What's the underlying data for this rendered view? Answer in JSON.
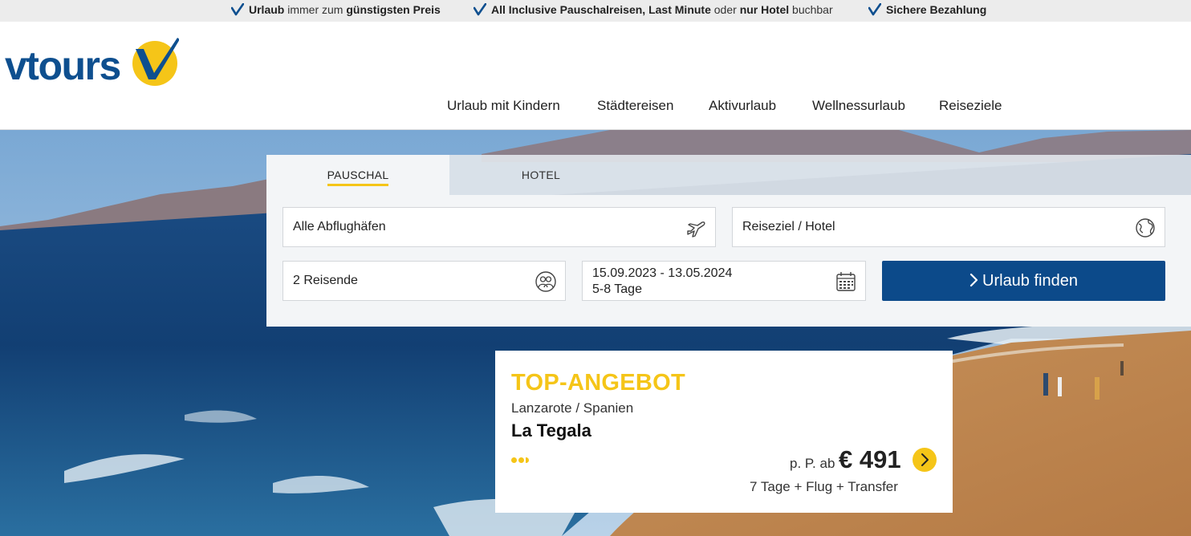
{
  "usp": {
    "item1": {
      "bold1": "Urlaub",
      "text1": " immer zum ",
      "bold2": "günstigsten Preis"
    },
    "item2": {
      "bold1": "All Inclusive Pauschalreisen, Last Minute",
      "text1": " oder ",
      "bold2": "nur Hotel",
      "text2": " buchbar"
    },
    "item3": {
      "bold1": "Sichere Bezahlung"
    }
  },
  "header": {
    "logo_text": "vtours",
    "nav": [
      "Urlaub mit Kindern",
      "Städtereisen",
      "Aktivurlaub",
      "Wellnessurlaub",
      "Reiseziele"
    ]
  },
  "search": {
    "tabs": [
      "PAUSCHAL",
      "HOTEL"
    ],
    "active_tab": "PAUSCHAL",
    "departure": {
      "value": "Alle Abflughäfen",
      "icon": "plane-icon"
    },
    "destination": {
      "placeholder": "Reiseziel / Hotel",
      "icon": "globe-icon"
    },
    "travelers": {
      "value": "2 Reisende",
      "icon": "travelers-icon"
    },
    "dates": {
      "range": "15.09.2023 - 13.05.2024",
      "duration": "5-8 Tage",
      "icon": "calendar-icon"
    },
    "submit_label": "Urlaub finden"
  },
  "offer": {
    "tag": "TOP-ANGEBOT",
    "location": "Lanzarote / Spanien",
    "hotel": "La Tegala",
    "stars": 3,
    "price_prefix": "p. P. ab",
    "price": "€ 491",
    "details": "7 Tage + Flug + Transfer"
  },
  "colors": {
    "brand_blue": "#0c4a8a",
    "accent_yellow": "#f5c518",
    "usp_bar": "#ececec"
  }
}
